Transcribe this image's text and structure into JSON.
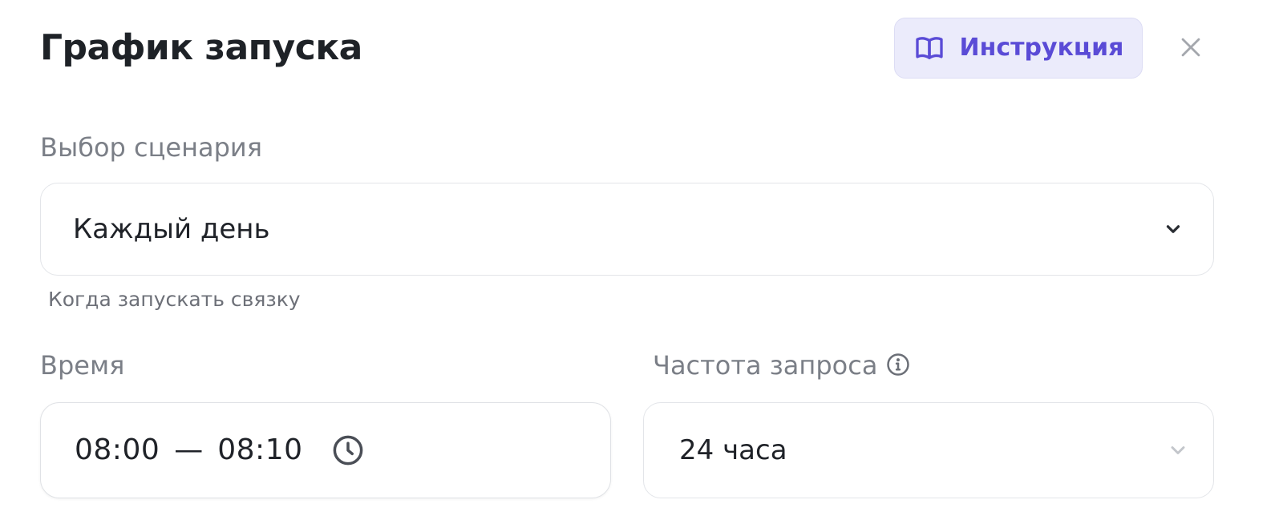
{
  "header": {
    "title": "График запуска",
    "guide_button_label": "Инструкция",
    "guide_icon": "book-icon",
    "close_icon": "close-icon"
  },
  "scenario": {
    "label": "Выбор сценария",
    "value": "Каждый день",
    "hint": "Когда запускать связку"
  },
  "time": {
    "label": "Время",
    "start": "08:00",
    "separator": "—",
    "end": "08:10",
    "icon": "clock-icon"
  },
  "frequency": {
    "label": "Частота запроса",
    "info_icon": "info-icon",
    "value": "24 часа"
  },
  "colors": {
    "accent": "#5a4bd6",
    "accent_bg": "#ebebfb",
    "label_gray": "#7b7f87",
    "border": "#e3e5e9"
  }
}
